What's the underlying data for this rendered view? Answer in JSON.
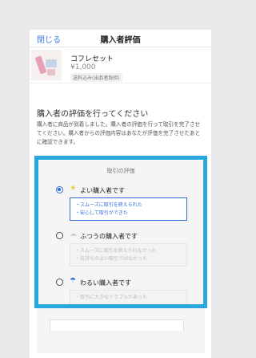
{
  "header": {
    "close_label": "閉じる",
    "title": "購入者評価"
  },
  "product": {
    "name": "コフレセット",
    "price": "¥1,000",
    "shipping_badge": "送料込み(出品者負担)"
  },
  "evaluation": {
    "section_title": "購入者の評価を行ってください",
    "description": "購入者に商品が到着しました。購入者の評価を行って取引を完了させてください。購入者からの評価内容はあなたが評価を完了させたあとに確認できます。",
    "card_label": "取引の評価",
    "options": [
      {
        "label": "よい購入者です",
        "icon": "sun-icon",
        "selected": true,
        "notes": [
          "・スムーズに取引を終えられた",
          "・安心して取引ができた"
        ]
      },
      {
        "label": "ふつうの購入者です",
        "icon": "cloud-icon",
        "selected": false,
        "notes": [
          "・スムーズに取引を終えられなかった",
          "・気持ちのよい取引ではなかった"
        ]
      },
      {
        "label": "わるい購入者です",
        "icon": "umbrella-icon",
        "selected": false,
        "notes": [
          "・取引に大きなトラブルがあった"
        ]
      }
    ]
  },
  "colors": {
    "accent": "#2d6fd7",
    "highlight": "#28a8df",
    "sun": "#f0b400"
  }
}
